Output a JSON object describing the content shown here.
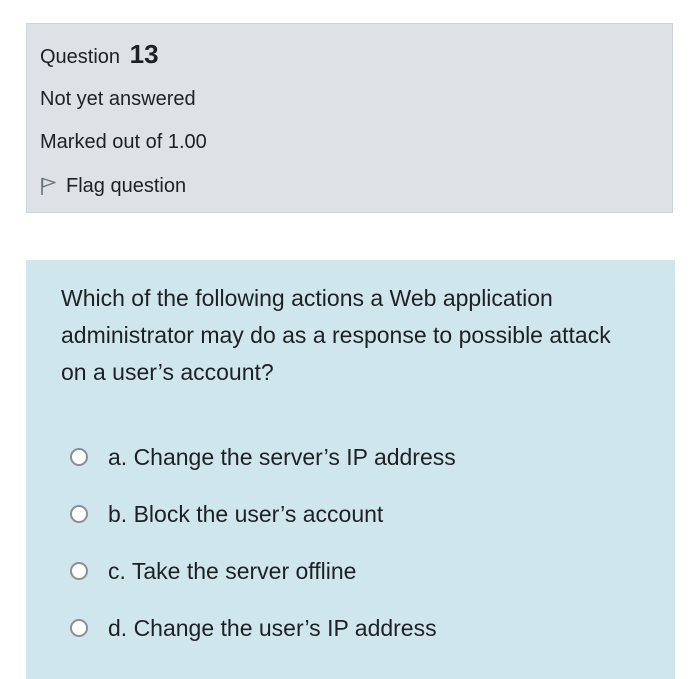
{
  "info": {
    "question_label": "Question",
    "question_number": "13",
    "state": "Not yet answered",
    "grade": "Marked out of 1.00",
    "flag_label": "Flag question"
  },
  "question": {
    "text": "Which of the following actions a Web application administrator may do as a response to possible attack on a user’s account?",
    "answers": [
      {
        "label": "a. Change the server’s IP address",
        "selected": false
      },
      {
        "label": "b. Block the user’s account",
        "selected": false
      },
      {
        "label": "c. Take the server offline",
        "selected": false
      },
      {
        "label": "d. Change the user’s IP address",
        "selected": false
      }
    ]
  },
  "colors": {
    "info_background": "#dee2e6",
    "content_background": "#cfe6ec",
    "text": "#1d2125"
  }
}
